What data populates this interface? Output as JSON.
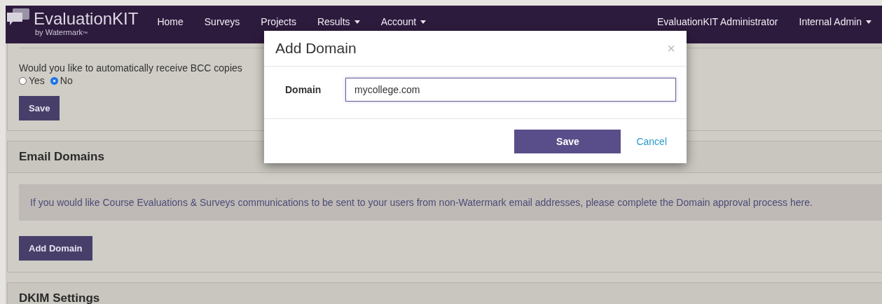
{
  "brand": {
    "name": "EvaluationKIT",
    "tagline": "by Watermark",
    "tm": "™"
  },
  "nav": [
    {
      "label": "Home",
      "dropdown": false
    },
    {
      "label": "Surveys",
      "dropdown": false
    },
    {
      "label": "Projects",
      "dropdown": false
    },
    {
      "label": "Results",
      "dropdown": true
    },
    {
      "label": "Account",
      "dropdown": true
    }
  ],
  "nav_right": [
    {
      "label": "EvaluationKIT Administrator",
      "dropdown": false
    },
    {
      "label": "Internal Admin",
      "dropdown": true
    }
  ],
  "bcc_panel": {
    "question": "Would you like to automatically receive BCC copies",
    "options": [
      {
        "label": "Yes",
        "selected": false
      },
      {
        "label": "No",
        "selected": true
      }
    ],
    "button": "Save"
  },
  "email_domains": {
    "title": "Email Domains",
    "info": "If you would like Course Evaluations & Surveys communications to be sent to your users from non-Watermark email addresses, please complete the Domain approval process here.",
    "button": "Add Domain"
  },
  "dkim": {
    "title": "DKIM Settings"
  },
  "modal": {
    "title": "Add Domain",
    "close": "×",
    "field_label": "Domain",
    "field_value": "mycollege.com",
    "save": "Save",
    "cancel": "Cancel"
  }
}
